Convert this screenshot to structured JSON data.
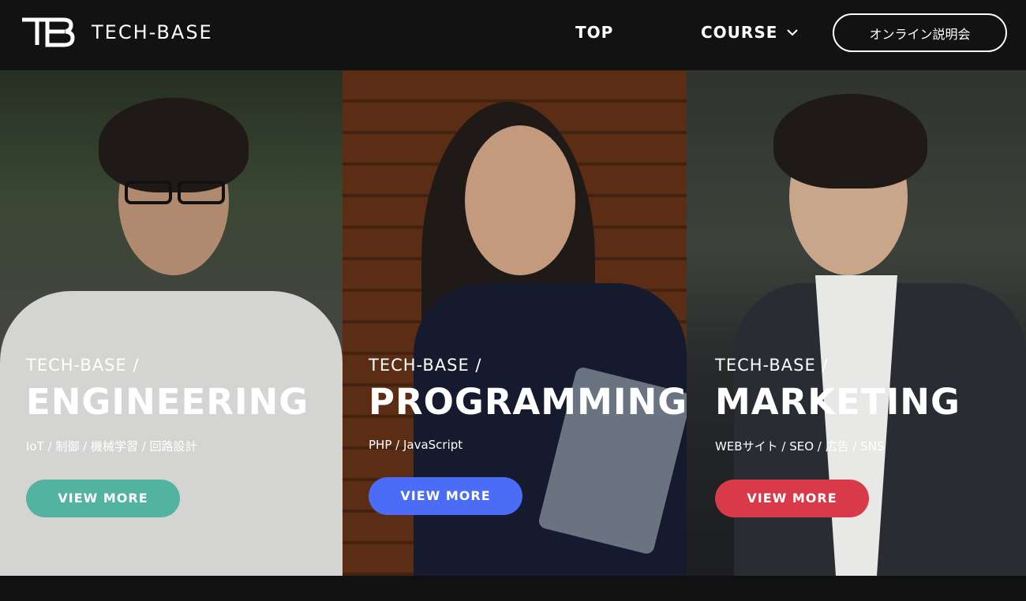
{
  "header": {
    "logo_text": "TECH-BASE",
    "nav": {
      "top": "TOP",
      "course": "COURSE"
    },
    "cta": "オンライン説明会"
  },
  "panels": [
    {
      "brand": "TECH-BASE /",
      "title": "ENGINEERING",
      "tags": "IoT / 制御 / 機械学習 / 回路設計",
      "button": "VIEW MORE",
      "button_color": "#52b3a0"
    },
    {
      "brand": "TECH-BASE /",
      "title": "PROGRAMMING",
      "tags": "PHP / JavaScript",
      "button": "VIEW MORE",
      "button_color": "#4a6cf7"
    },
    {
      "brand": "TECH-BASE /",
      "title": "MARKETING",
      "tags": "WEBサイト / SEO / 広告 / SNS",
      "button": "VIEW MORE",
      "button_color": "#d93a4a"
    }
  ],
  "icons": {
    "logo": "tb-logo-icon",
    "course_dropdown": "chevron-down-icon"
  }
}
